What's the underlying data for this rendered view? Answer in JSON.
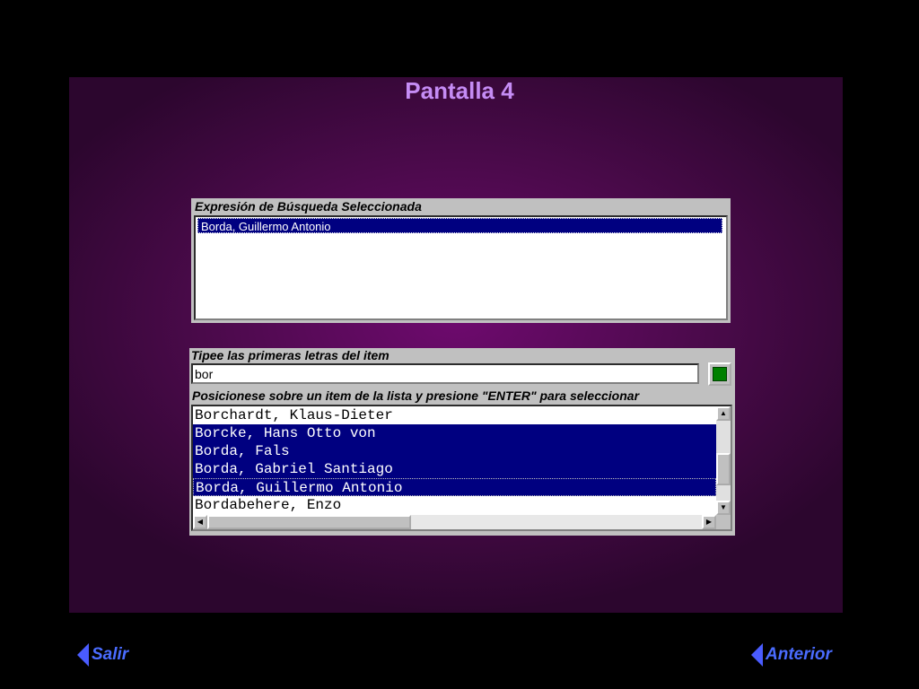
{
  "screen": {
    "title": "Pantalla 4"
  },
  "selected_panel": {
    "label": "Expresión de Búsqueda Seleccionada",
    "items": [
      "Borda, Guillermo Antonio"
    ]
  },
  "search_panel": {
    "input_label": "Tipee las primeras letras del item",
    "input_value": "bor",
    "list_label": "Posicionese sobre un item de la lista y presione \"ENTER\" para seleccionar",
    "results": [
      "Borchardt, Klaus-Dieter",
      "Borcke, Hans Otto von",
      "Borda, Fals",
      "Borda, Gabriel Santiago",
      "Borda, Guillermo Antonio",
      "Bordabehere, Enzo"
    ],
    "highlighted": [
      1,
      2,
      3,
      4
    ]
  },
  "nav": {
    "exit_label": "Salir",
    "back_label": "Anterior"
  },
  "colors": {
    "accent": "#4a6cff",
    "title": "#c58cf5",
    "selection": "#000080",
    "go_button": "#008000"
  }
}
